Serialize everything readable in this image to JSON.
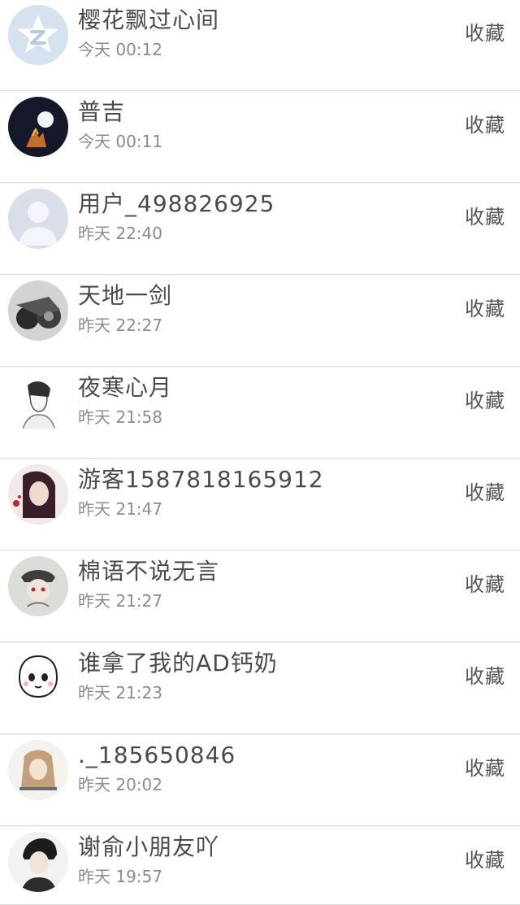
{
  "items": [
    {
      "name": "樱花飘过心间",
      "time": "今天 00:12",
      "action": "收藏",
      "avatar_icon": "qzone-star-icon"
    },
    {
      "name": "普吉",
      "time": "今天 00:11",
      "action": "收藏",
      "avatar_icon": "night-moon-avatar"
    },
    {
      "name": "用户_498826925",
      "time": "昨天 22:40",
      "action": "收藏",
      "avatar_icon": "default-user-icon"
    },
    {
      "name": "天地一剑",
      "time": "昨天 22:27",
      "action": "收藏",
      "avatar_icon": "bike-avatar"
    },
    {
      "name": "夜寒心月",
      "time": "昨天 21:58",
      "action": "收藏",
      "avatar_icon": "sketch-boy-avatar"
    },
    {
      "name": "游客1587818165912",
      "time": "昨天 21:47",
      "action": "收藏",
      "avatar_icon": "girl-portrait-avatar"
    },
    {
      "name": "棉语不说无言",
      "time": "昨天 21:27",
      "action": "收藏",
      "avatar_icon": "masked-character-avatar"
    },
    {
      "name": "谁拿了我的AD钙奶",
      "time": "昨天 21:23",
      "action": "收藏",
      "avatar_icon": "cartoon-kid-avatar"
    },
    {
      "name": "._185650846",
      "time": "昨天 20:02",
      "action": "收藏",
      "avatar_icon": "anime-girl-avatar"
    },
    {
      "name": "谢俞小朋友吖",
      "time": "昨天 19:57",
      "action": "收藏",
      "avatar_icon": "dark-hair-avatar"
    }
  ],
  "colors": {
    "name_text": "#4a4a4a",
    "time_text": "#8c8c8c",
    "action_text": "#555555",
    "divider": "#dcdcdc",
    "background": "#ffffff"
  }
}
